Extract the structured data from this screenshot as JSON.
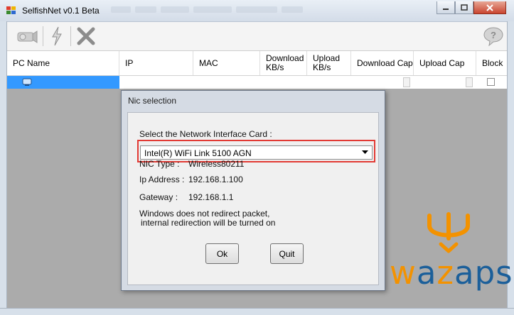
{
  "window": {
    "title": "SelfishNet v0.1 Beta"
  },
  "grid": {
    "columns": [
      {
        "label": "PC Name"
      },
      {
        "label": "IP"
      },
      {
        "label": "MAC"
      },
      {
        "label": "Download\nKB/s"
      },
      {
        "label": "Upload\nKB/s"
      },
      {
        "label": "Download Cap"
      },
      {
        "label": "Upload Cap"
      },
      {
        "label": "Block"
      }
    ]
  },
  "dialog": {
    "title": "Nic selection",
    "select_label": "Select the Network Interface Card :",
    "selected_nic": "Intel(R) WiFi Link 5100 AGN",
    "nic_type_label": "NIC Type :",
    "nic_type_value": "Wireless80211",
    "ip_label": "Ip Address :",
    "ip_value": "192.168.1.100",
    "gateway_label": "Gateway :",
    "gateway_value": "192.168.1.1",
    "message_line1": "Windows does not redirect packet,",
    "message_line2": "internal redirection will be turned on",
    "ok_label": "Ok",
    "quit_label": "Quit"
  },
  "watermark": {
    "part1": "w",
    "part2": "a",
    "part3": "z",
    "part4": "aps"
  },
  "colors": {
    "selection": "#3399ff",
    "highlight": "#e23a34",
    "watermark_orange": "#f39200",
    "watermark_blue": "#1b5f9a"
  }
}
